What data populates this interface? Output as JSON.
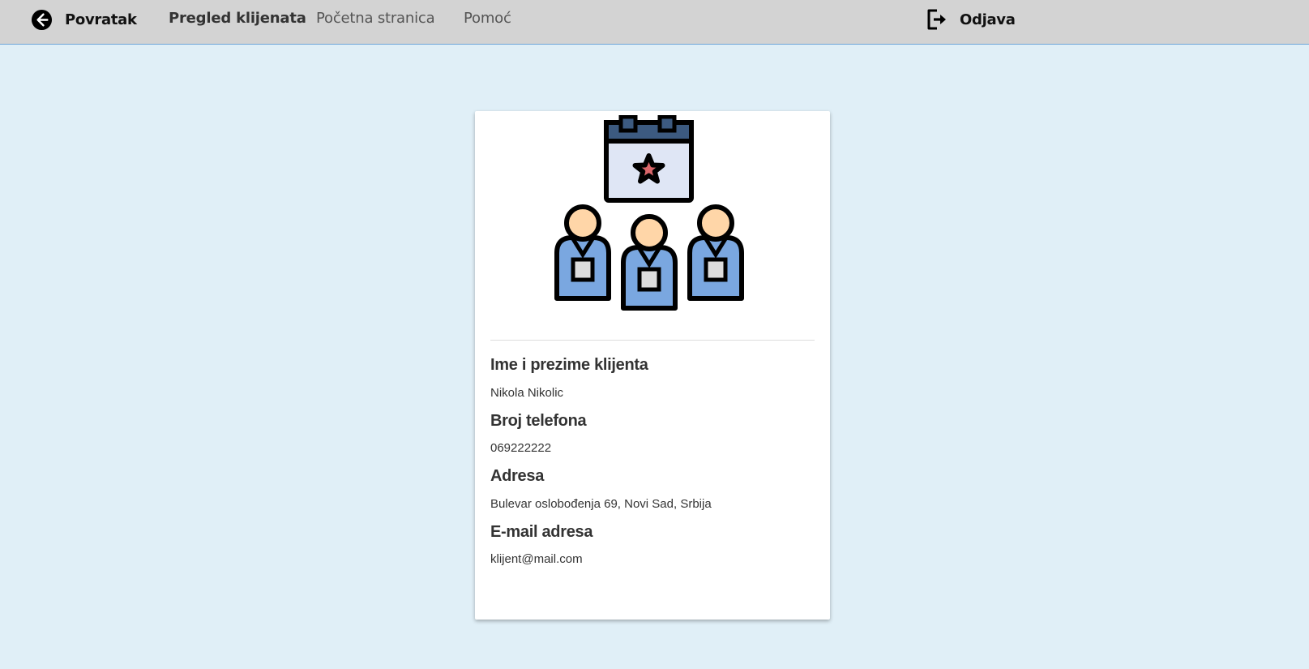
{
  "header": {
    "back_label": "Povratak",
    "nav": [
      {
        "label": "Pregled klijenata",
        "active": true
      },
      {
        "label": "Početna stranica",
        "active": false
      },
      {
        "label": "Pomoć",
        "active": false
      }
    ],
    "logout_label": "Odjava"
  },
  "icons": {
    "back": "arrow-left-circle-icon",
    "logout": "logout-icon",
    "illustration": "clients-calendar-star-illustration"
  },
  "client": {
    "fields": [
      {
        "label": "Ime i prezime klijenta",
        "value": "Nikola Nikolic"
      },
      {
        "label": "Broj telefona",
        "value": "069222222"
      },
      {
        "label": "Adresa",
        "value": "Bulevar oslobođenja 69, Novi Sad, Srbija"
      },
      {
        "label": "E-mail adresa",
        "value": "klijent@mail.com"
      }
    ]
  },
  "colors": {
    "page_background": "#e0eff7",
    "topbar_background": "#d3d3d3",
    "card_background": "#ffffff",
    "person_body": "#7aa7e0",
    "person_head": "#ffd6a8",
    "calendar_header": "#3c5a80",
    "calendar_body": "#dfe6f5",
    "star": "#d9666a"
  }
}
